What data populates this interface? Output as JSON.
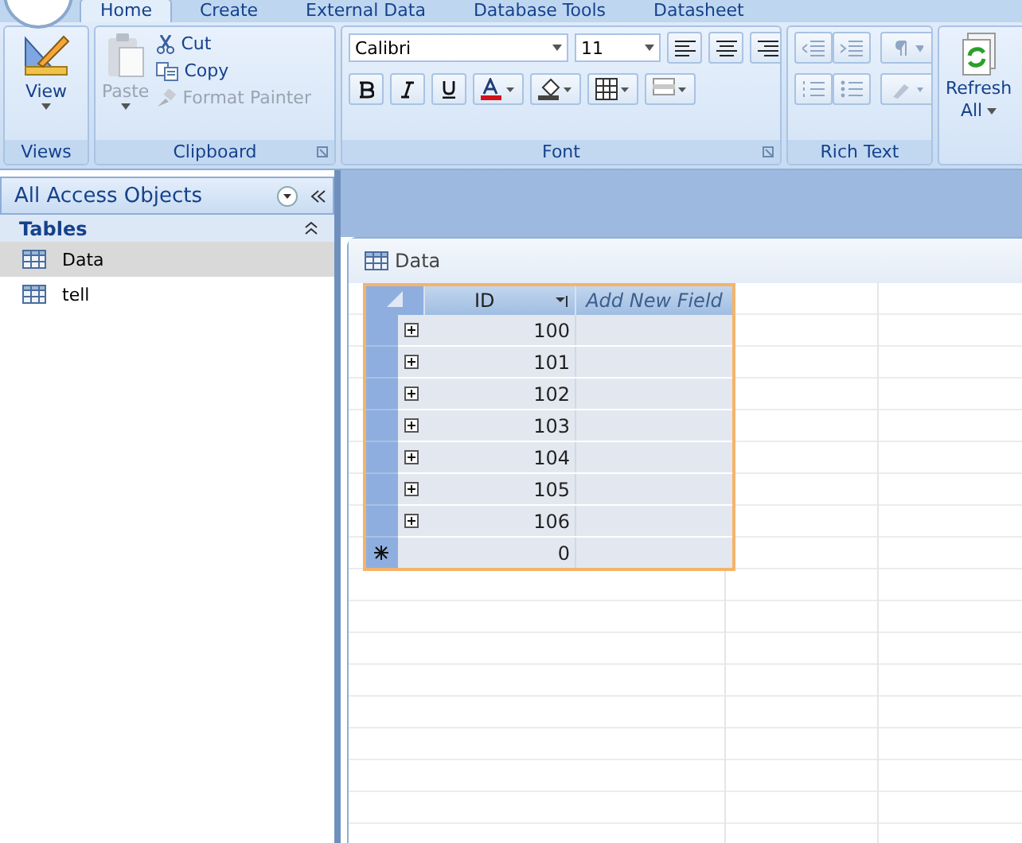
{
  "ribbon": {
    "tabs": [
      {
        "label": "Home",
        "selected": true
      },
      {
        "label": "Create",
        "selected": false
      },
      {
        "label": "External Data",
        "selected": false
      },
      {
        "label": "Database Tools",
        "selected": false
      },
      {
        "label": "Datasheet",
        "selected": false
      }
    ],
    "views": {
      "button": "View",
      "label": "Views"
    },
    "clipboard": {
      "paste": {
        "label": "Paste",
        "disabled": true
      },
      "items": [
        {
          "kind": "cut",
          "label": "Cut",
          "disabled": false
        },
        {
          "kind": "copy",
          "label": "Copy",
          "disabled": false
        },
        {
          "kind": "painter",
          "label": "Format Painter",
          "disabled": true
        }
      ],
      "label": "Clipboard"
    },
    "font": {
      "family": "Calibri",
      "size": "11",
      "label": "Font"
    },
    "rich_text": {
      "label": "Rich Text"
    },
    "refresh": {
      "label": "Refresh",
      "sub": "All"
    }
  },
  "nav": {
    "title": "All Access Objects",
    "section": "Tables",
    "items": [
      {
        "label": "Data",
        "selected": true
      },
      {
        "label": "tell",
        "selected": false
      }
    ]
  },
  "datasheet": {
    "title": "Data",
    "columns": [
      "ID",
      "Add New Field"
    ],
    "rows": [
      "100",
      "101",
      "102",
      "103",
      "104",
      "105",
      "106"
    ],
    "new_row": "0"
  }
}
